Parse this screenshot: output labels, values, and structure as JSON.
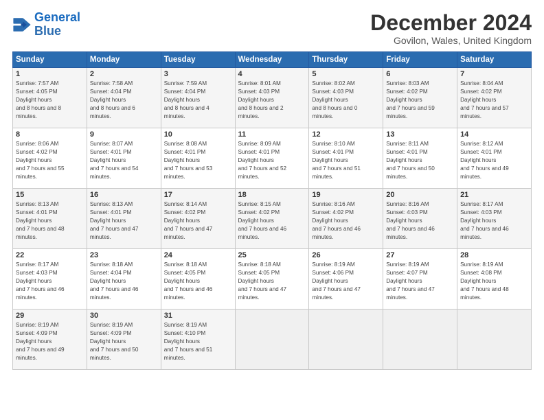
{
  "header": {
    "logo_line1": "General",
    "logo_line2": "Blue",
    "month": "December 2024",
    "location": "Govilon, Wales, United Kingdom"
  },
  "weekdays": [
    "Sunday",
    "Monday",
    "Tuesday",
    "Wednesday",
    "Thursday",
    "Friday",
    "Saturday"
  ],
  "weeks": [
    [
      {
        "day": "1",
        "rise": "7:57 AM",
        "set": "4:05 PM",
        "daylight": "8 hours and 8 minutes."
      },
      {
        "day": "2",
        "rise": "7:58 AM",
        "set": "4:04 PM",
        "daylight": "8 hours and 6 minutes."
      },
      {
        "day": "3",
        "rise": "7:59 AM",
        "set": "4:04 PM",
        "daylight": "8 hours and 4 minutes."
      },
      {
        "day": "4",
        "rise": "8:01 AM",
        "set": "4:03 PM",
        "daylight": "8 hours and 2 minutes."
      },
      {
        "day": "5",
        "rise": "8:02 AM",
        "set": "4:03 PM",
        "daylight": "8 hours and 0 minutes."
      },
      {
        "day": "6",
        "rise": "8:03 AM",
        "set": "4:02 PM",
        "daylight": "7 hours and 59 minutes."
      },
      {
        "day": "7",
        "rise": "8:04 AM",
        "set": "4:02 PM",
        "daylight": "7 hours and 57 minutes."
      }
    ],
    [
      {
        "day": "8",
        "rise": "8:06 AM",
        "set": "4:02 PM",
        "daylight": "7 hours and 55 minutes."
      },
      {
        "day": "9",
        "rise": "8:07 AM",
        "set": "4:01 PM",
        "daylight": "7 hours and 54 minutes."
      },
      {
        "day": "10",
        "rise": "8:08 AM",
        "set": "4:01 PM",
        "daylight": "7 hours and 53 minutes."
      },
      {
        "day": "11",
        "rise": "8:09 AM",
        "set": "4:01 PM",
        "daylight": "7 hours and 52 minutes."
      },
      {
        "day": "12",
        "rise": "8:10 AM",
        "set": "4:01 PM",
        "daylight": "7 hours and 51 minutes."
      },
      {
        "day": "13",
        "rise": "8:11 AM",
        "set": "4:01 PM",
        "daylight": "7 hours and 50 minutes."
      },
      {
        "day": "14",
        "rise": "8:12 AM",
        "set": "4:01 PM",
        "daylight": "7 hours and 49 minutes."
      }
    ],
    [
      {
        "day": "15",
        "rise": "8:13 AM",
        "set": "4:01 PM",
        "daylight": "7 hours and 48 minutes."
      },
      {
        "day": "16",
        "rise": "8:13 AM",
        "set": "4:01 PM",
        "daylight": "7 hours and 47 minutes."
      },
      {
        "day": "17",
        "rise": "8:14 AM",
        "set": "4:02 PM",
        "daylight": "7 hours and 47 minutes."
      },
      {
        "day": "18",
        "rise": "8:15 AM",
        "set": "4:02 PM",
        "daylight": "7 hours and 46 minutes."
      },
      {
        "day": "19",
        "rise": "8:16 AM",
        "set": "4:02 PM",
        "daylight": "7 hours and 46 minutes."
      },
      {
        "day": "20",
        "rise": "8:16 AM",
        "set": "4:03 PM",
        "daylight": "7 hours and 46 minutes."
      },
      {
        "day": "21",
        "rise": "8:17 AM",
        "set": "4:03 PM",
        "daylight": "7 hours and 46 minutes."
      }
    ],
    [
      {
        "day": "22",
        "rise": "8:17 AM",
        "set": "4:03 PM",
        "daylight": "7 hours and 46 minutes."
      },
      {
        "day": "23",
        "rise": "8:18 AM",
        "set": "4:04 PM",
        "daylight": "7 hours and 46 minutes."
      },
      {
        "day": "24",
        "rise": "8:18 AM",
        "set": "4:05 PM",
        "daylight": "7 hours and 46 minutes."
      },
      {
        "day": "25",
        "rise": "8:18 AM",
        "set": "4:05 PM",
        "daylight": "7 hours and 47 minutes."
      },
      {
        "day": "26",
        "rise": "8:19 AM",
        "set": "4:06 PM",
        "daylight": "7 hours and 47 minutes."
      },
      {
        "day": "27",
        "rise": "8:19 AM",
        "set": "4:07 PM",
        "daylight": "7 hours and 47 minutes."
      },
      {
        "day": "28",
        "rise": "8:19 AM",
        "set": "4:08 PM",
        "daylight": "7 hours and 48 minutes."
      }
    ],
    [
      {
        "day": "29",
        "rise": "8:19 AM",
        "set": "4:09 PM",
        "daylight": "7 hours and 49 minutes."
      },
      {
        "day": "30",
        "rise": "8:19 AM",
        "set": "4:09 PM",
        "daylight": "7 hours and 50 minutes."
      },
      {
        "day": "31",
        "rise": "8:19 AM",
        "set": "4:10 PM",
        "daylight": "7 hours and 51 minutes."
      },
      null,
      null,
      null,
      null
    ]
  ]
}
